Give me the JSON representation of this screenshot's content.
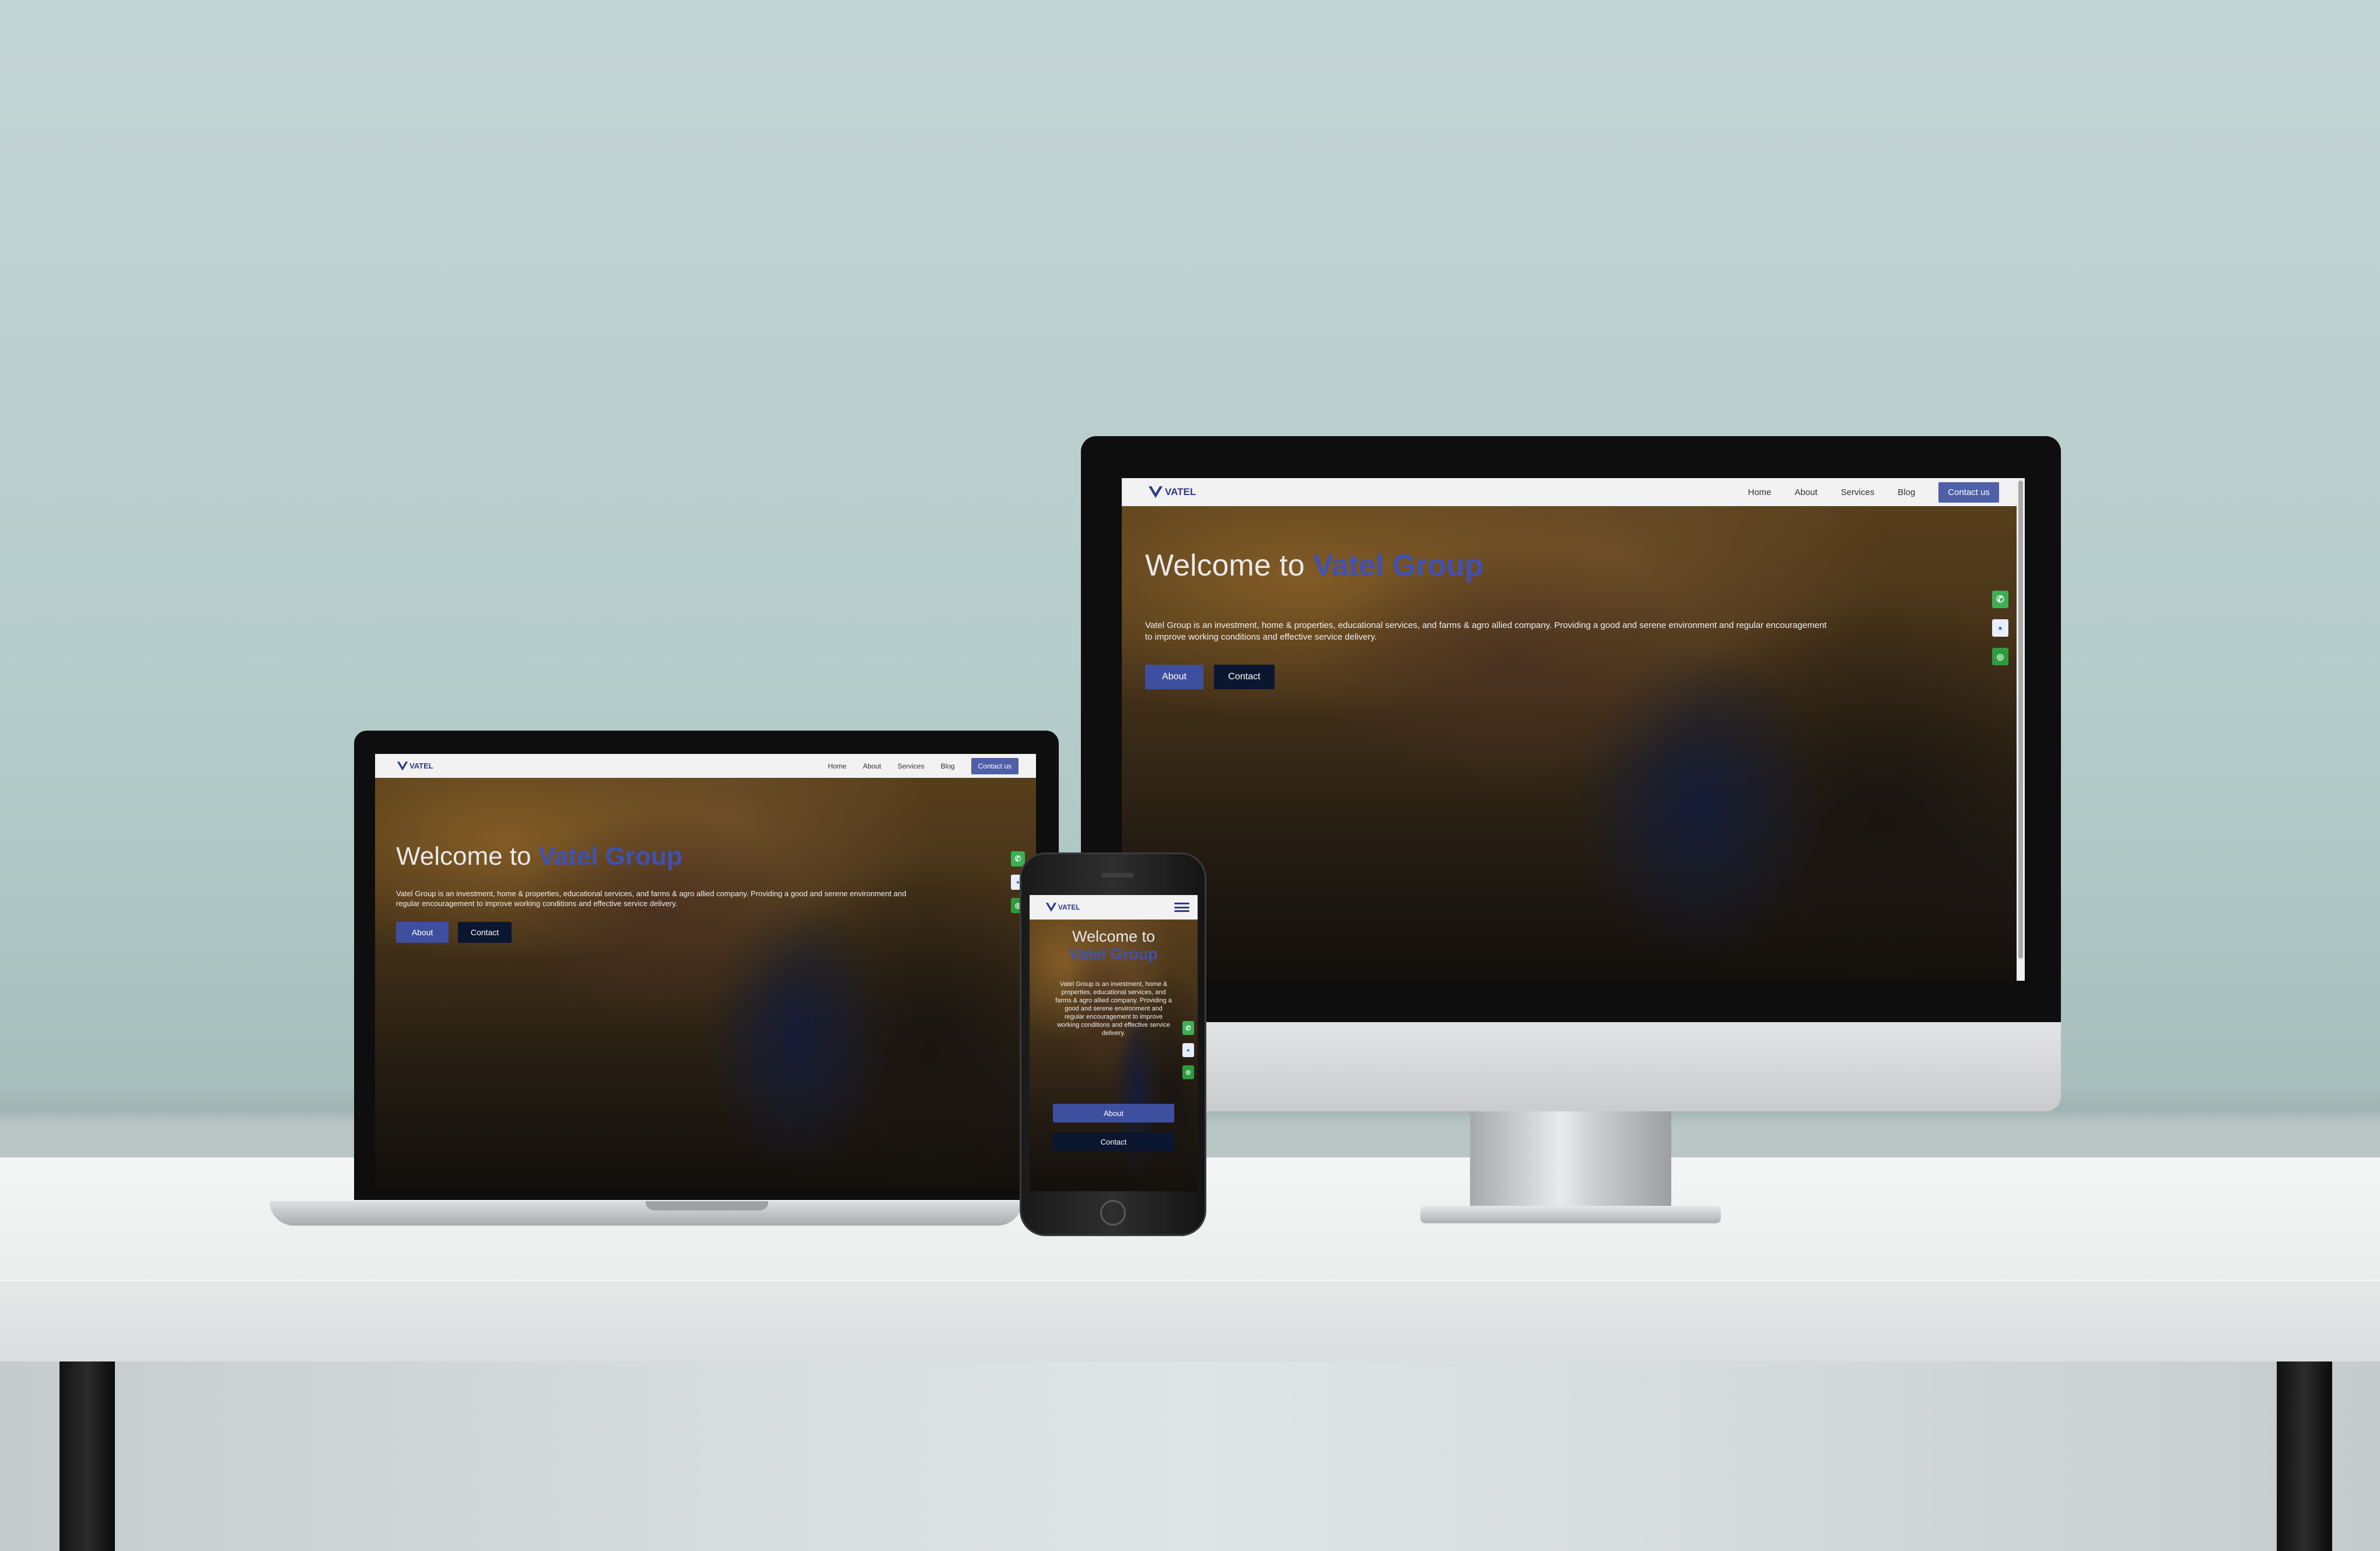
{
  "brand": {
    "logo_text": "VATEL",
    "accent_color": "#3f51b5",
    "nav_bg": "#f2f2f2",
    "cta_color": "#4f5fa8",
    "contact_btn_color": "#0b1630"
  },
  "nav": {
    "items": [
      "Home",
      "About",
      "Services",
      "Blog"
    ],
    "cta": "Contact us"
  },
  "hero": {
    "title_prefix": "Welcome to",
    "title_accent": "Vatel Group",
    "description": "Vatel Group is an investment, home & properties, educational services, and farms & agro allied company. Providing a good and serene environment and regular encouragement to improve working conditions and effective service delivery.",
    "buttons": {
      "about": "About",
      "contact": "Contact"
    }
  },
  "floating_icons": [
    {
      "name": "phone",
      "glyph": "✆"
    },
    {
      "name": "messenger",
      "glyph": "●"
    },
    {
      "name": "whatsapp",
      "glyph": "◎"
    }
  ]
}
